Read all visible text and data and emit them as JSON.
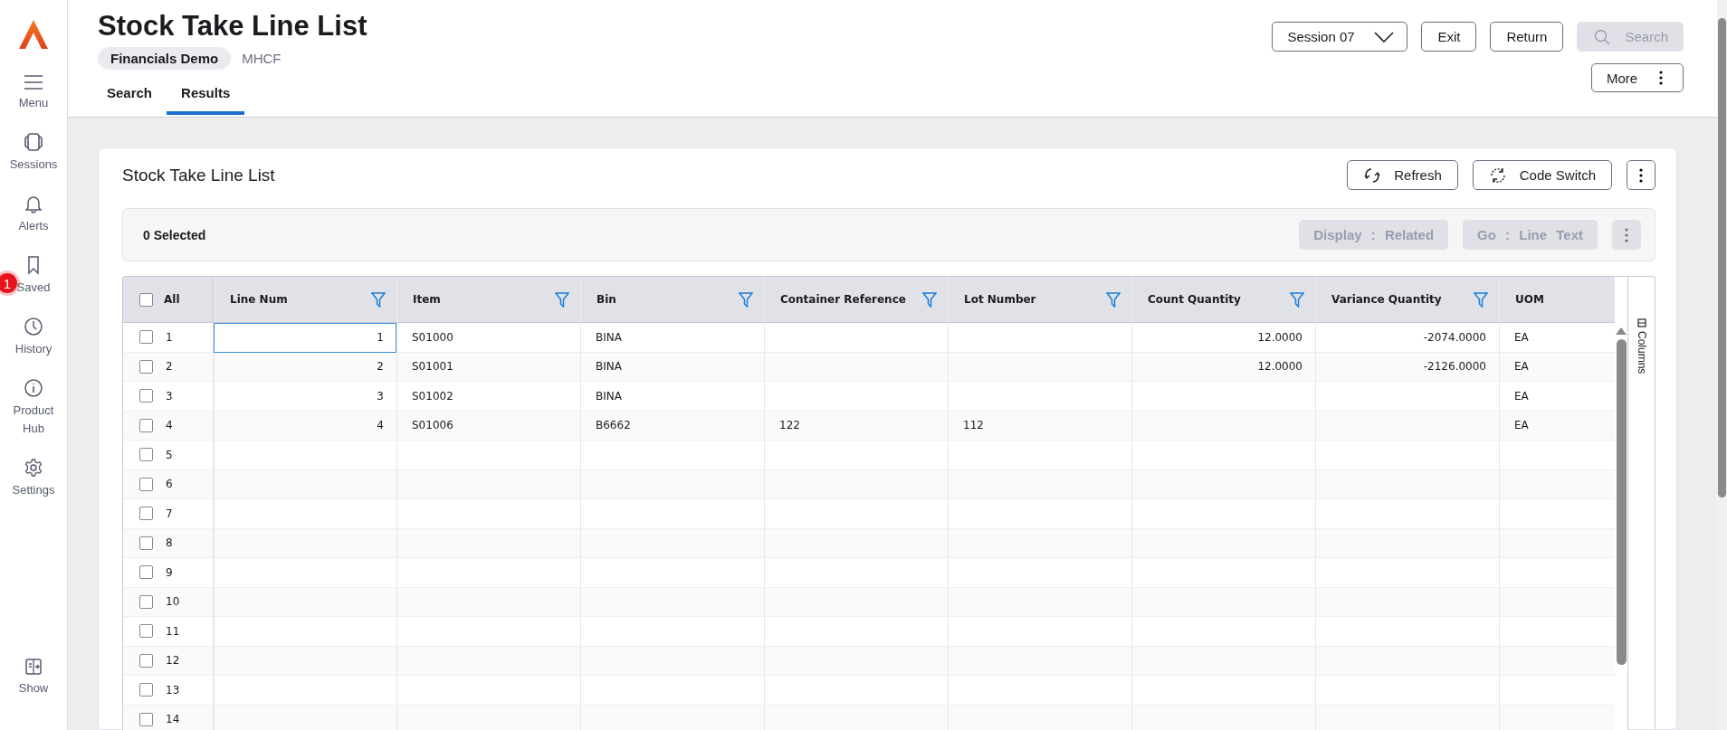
{
  "sidebar": {
    "items": [
      {
        "kind": "menu",
        "label": "Menu"
      },
      {
        "kind": "sessions",
        "label": "Sessions"
      },
      {
        "kind": "alerts",
        "label": "Alerts"
      },
      {
        "kind": "saved",
        "label": "Saved",
        "badge": "1"
      },
      {
        "kind": "history",
        "label": "History"
      },
      {
        "kind": "info",
        "label": "Product Hub"
      },
      {
        "kind": "settings",
        "label": "Settings"
      }
    ],
    "bottom_item": {
      "kind": "show",
      "label": "Show"
    }
  },
  "header": {
    "title": "Stock Take Line List",
    "company": "Financials Demo",
    "code": "MHCF",
    "tabs": [
      {
        "label": "Search",
        "selected": false
      },
      {
        "label": "Results",
        "selected": true
      }
    ],
    "session": "Session 07",
    "buttons": [
      {
        "label": "Exit",
        "disabled": false
      },
      {
        "label": "Return",
        "disabled": false
      },
      {
        "label": "Search",
        "disabled": true
      }
    ],
    "more": "More"
  },
  "card": {
    "title": "Stock Take Line List",
    "buttons": [
      {
        "label": "Refresh"
      },
      {
        "label": "Code Switch"
      }
    ],
    "selection": "0 Selected",
    "actions": [
      {
        "label": "Display : Related",
        "disabled": true
      },
      {
        "label": "Go : Line Text",
        "disabled": true
      }
    ]
  },
  "table": {
    "all_label": "All",
    "all_checked": false,
    "columns_panel": "Columns",
    "columns": [
      {
        "label": "Line Num",
        "kind": "number",
        "filter": true
      },
      {
        "label": "Item",
        "kind": "text",
        "filter": true
      },
      {
        "label": "Bin",
        "kind": "text",
        "filter": true
      },
      {
        "label": "Container Reference",
        "kind": "text",
        "filter": true
      },
      {
        "label": "Lot Number",
        "kind": "text",
        "filter": true
      },
      {
        "label": "Count Quantity",
        "kind": "number",
        "filter": true
      },
      {
        "label": "Variance Quantity",
        "kind": "number",
        "filter": true
      },
      {
        "label": "UOM",
        "kind": "text",
        "filter": false
      }
    ],
    "rows": [
      {
        "num": "1",
        "checked": false,
        "focused": true,
        "cells": [
          "1",
          "S01000",
          "BINA",
          "",
          "",
          "12.0000",
          "-2074.0000",
          "EA"
        ]
      },
      {
        "num": "2",
        "checked": false,
        "focused": false,
        "cells": [
          "2",
          "S01001",
          "BINA",
          "",
          "",
          "12.0000",
          "-2126.0000",
          "EA"
        ]
      },
      {
        "num": "3",
        "checked": false,
        "focused": false,
        "cells": [
          "3",
          "S01002",
          "BINA",
          "",
          "",
          "",
          "",
          "EA"
        ]
      },
      {
        "num": "4",
        "checked": false,
        "focused": false,
        "cells": [
          "4",
          "S01006",
          "B6662",
          "122",
          "112",
          "",
          "",
          "EA"
        ]
      },
      {
        "num": "5",
        "checked": false,
        "focused": false,
        "cells": [
          "",
          "",
          "",
          "",
          "",
          "",
          "",
          ""
        ]
      },
      {
        "num": "6",
        "checked": false,
        "focused": false,
        "cells": [
          "",
          "",
          "",
          "",
          "",
          "",
          "",
          ""
        ]
      },
      {
        "num": "7",
        "checked": false,
        "focused": false,
        "cells": [
          "",
          "",
          "",
          "",
          "",
          "",
          "",
          ""
        ]
      },
      {
        "num": "8",
        "checked": false,
        "focused": false,
        "cells": [
          "",
          "",
          "",
          "",
          "",
          "",
          "",
          ""
        ]
      },
      {
        "num": "9",
        "checked": false,
        "focused": false,
        "cells": [
          "",
          "",
          "",
          "",
          "",
          "",
          "",
          ""
        ]
      },
      {
        "num": "10",
        "checked": false,
        "focused": false,
        "cells": [
          "",
          "",
          "",
          "",
          "",
          "",
          "",
          ""
        ]
      },
      {
        "num": "11",
        "checked": false,
        "focused": false,
        "cells": [
          "",
          "",
          "",
          "",
          "",
          "",
          "",
          ""
        ]
      },
      {
        "num": "12",
        "checked": false,
        "focused": false,
        "cells": [
          "",
          "",
          "",
          "",
          "",
          "",
          "",
          ""
        ]
      },
      {
        "num": "13",
        "checked": false,
        "focused": false,
        "cells": [
          "",
          "",
          "",
          "",
          "",
          "",
          "",
          ""
        ]
      },
      {
        "num": "14",
        "checked": false,
        "focused": false,
        "cells": [
          "",
          "",
          "",
          "",
          "",
          "",
          "",
          ""
        ]
      }
    ]
  }
}
